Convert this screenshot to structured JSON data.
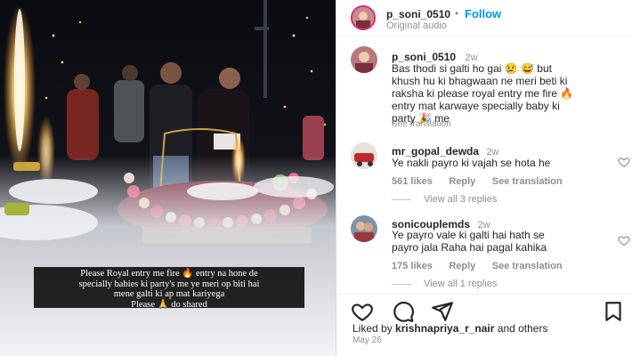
{
  "post": {
    "username": "p_soni_0510",
    "dot": "•",
    "follow_label": "Follow",
    "audio": "Original audio"
  },
  "caption_comment": {
    "username": "p_soni_0510",
    "time": "2w",
    "lines": [
      "Bas thodi si galti ho gai 😢 😅 but",
      "khush hu ki bhagwaan ne meri beti ki",
      "raksha ki please royal entry me fire 🔥",
      "entry mat karwaye specially baby ki",
      "party 🎉 me"
    ],
    "see_translation": "See translation"
  },
  "comments": [
    {
      "username": "mr_gopal_dewda",
      "time": "2w",
      "text_lines": [
        "Ye nakli payro ki vajah se hota he"
      ],
      "likes": "561 likes",
      "reply": "Reply",
      "see_translation": "See translation",
      "view_replies": "View all 3 replies"
    },
    {
      "username": "sonicouplemds",
      "time": "2w",
      "text_lines": [
        "Ye payro vale ki galti hai hath se",
        "payro jala Raha hai pagal kahika"
      ],
      "likes": "175 likes",
      "reply": "Reply",
      "see_translation": "See translation",
      "view_replies": "View all 1 replies"
    }
  ],
  "likes_line": {
    "prefix": "Liked by ",
    "user": "krishnapriya_r_nair",
    "suffix": " and others"
  },
  "date": "May 26",
  "video_caption": {
    "lines": [
      "Please Royal entry me fire 🔥 entry na hone de",
      "specially babies ki party's me ye meri op biti hai",
      "mene galti ki ap mat kariyega",
      "Please 🙏 do shared"
    ]
  },
  "icons": [
    "heart-icon",
    "comment-icon",
    "share-icon",
    "bookmark-icon"
  ],
  "colors": {
    "follow": "#0095f6",
    "text": "#262626",
    "muted": "#8e8e8e",
    "ring": "#d62976"
  }
}
